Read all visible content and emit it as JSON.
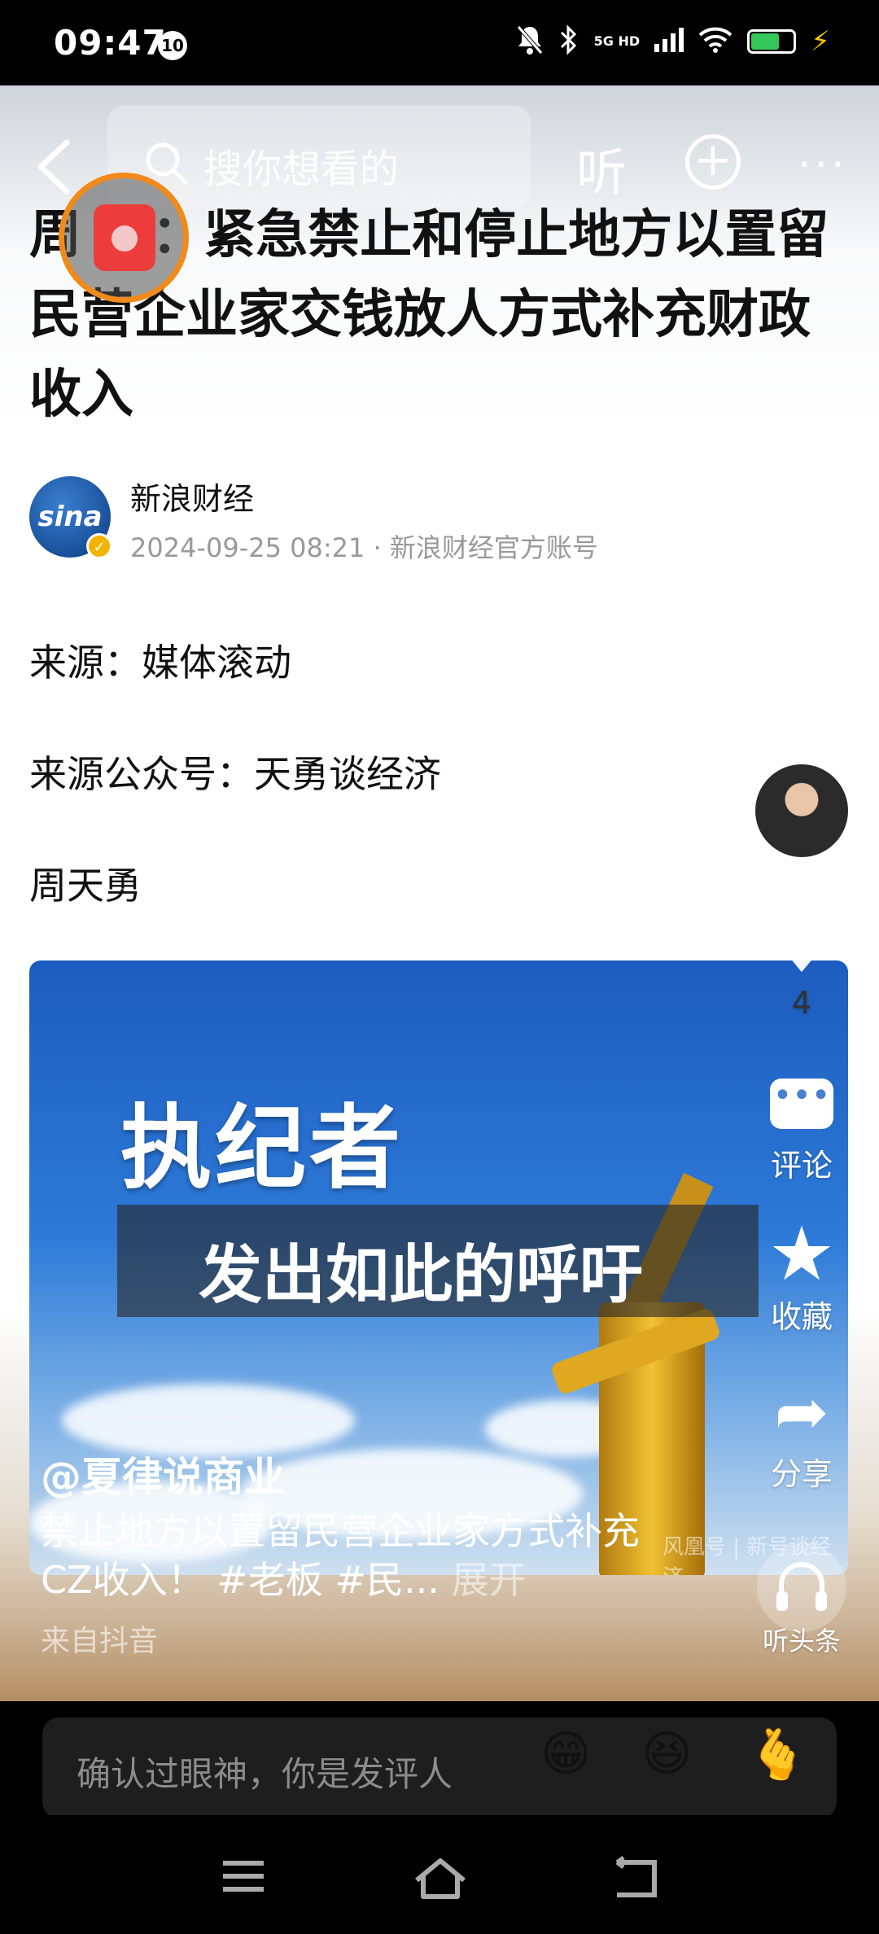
{
  "status_bar": {
    "time": "09:47",
    "notif_count": "10",
    "network": "5G HD"
  },
  "nav": {
    "search_placeholder": "搜你想看的",
    "listen_label": "听"
  },
  "article": {
    "title": "周天勇：紧急禁止和停止地方以置留民营企业家交钱放人方式补充财政收入",
    "title_visible": "周    勇：紧急禁止和停止地方以置留民营企业家交钱放人方式补充财政收入",
    "author": "新浪财经",
    "avatar_text": "sina",
    "timestamp": "2024-09-25 08:21",
    "account_note": "新浪财经官方账号",
    "paragraphs": [
      "来源：媒体滚动",
      "来源公众号：天勇谈经济",
      "周天勇"
    ]
  },
  "video": {
    "overlay_title": "执纪者",
    "banner_text": "发出如此的呼吁",
    "watermark": "风凰号 | 新号谈经济",
    "handle": "@夏律说商业",
    "description": "禁止地方以置留民营企业家方式补充CZ收入！ #老板 #民...",
    "expand": "展开",
    "source": "来自抖音"
  },
  "rail": {
    "like_count": "4",
    "comment_label": "评论",
    "favorite_label": "收藏",
    "share_label": "分享",
    "listen_label": "听头条"
  },
  "comment_bar": {
    "placeholder": "确认过眼神，你是发评人",
    "emojis": [
      "😁",
      "😆",
      "🫰"
    ]
  }
}
